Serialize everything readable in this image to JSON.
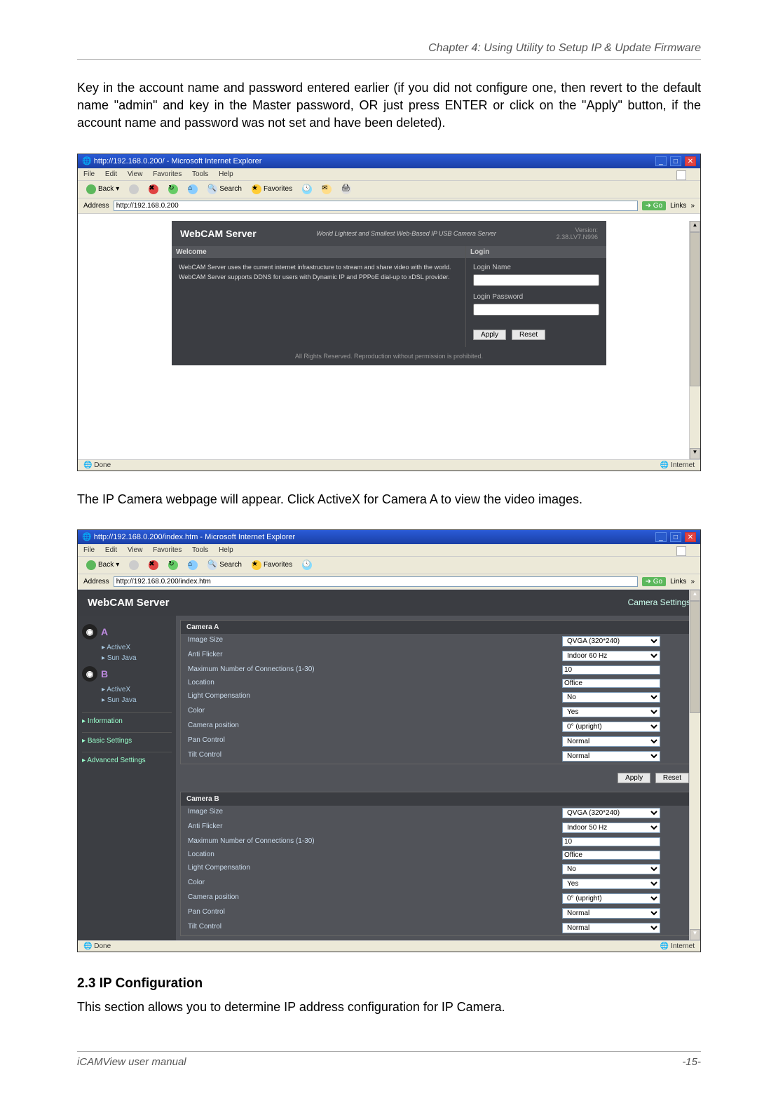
{
  "chapter_header": "Chapter 4: Using Utility to Setup IP & Update Firmware",
  "intro_text": "Key in the account name and password entered earlier (if you did not configure one, then revert to the default name \"admin\" and key in the Master password, OR just press ENTER or click on the \"Apply\" button, if the account name and password was not set and have been deleted).",
  "s1": {
    "title": "http://192.168.0.200/ - Microsoft Internet Explorer",
    "menubar": [
      "File",
      "Edit",
      "View",
      "Favorites",
      "Tools",
      "Help"
    ],
    "toolbar": {
      "back": "Back",
      "search": "Search",
      "favorites": "Favorites"
    },
    "address_label": "Address",
    "address_value": "http://192.168.0.200",
    "go": "Go",
    "links": "Links",
    "webcam_title": "WebCAM Server",
    "subtitle": "World Lightest and Smallest\nWeb-Based IP USB Camera Server",
    "version_label": "Version:",
    "version_value": "2.38.LV7.N996",
    "welcome_header": "Welcome",
    "welcome_text1": "WebCAM Server uses the current internet infrastructure to stream and share video with the world.",
    "welcome_text2": "WebCAM Server supports DDNS for users with Dynamic IP and PPPoE dial-up to xDSL provider.",
    "login_header": "Login",
    "login_name": "Login Name",
    "login_password": "Login Password",
    "apply": "Apply",
    "reset": "Reset",
    "footer": "All Rights Reserved. Reproduction without permission is prohibited.",
    "status_left": "Done",
    "status_right": "Internet"
  },
  "mid_text": "The IP Camera webpage will appear.   Click ActiveX for Camera A to view the video images.",
  "s2": {
    "title": "http://192.168.0.200/index.htm - Microsoft Internet Explorer",
    "address_value": "http://192.168.0.200/index.htm",
    "banner_title": "WebCAM Server",
    "camera_settings": "Camera Settings",
    "sidebar": {
      "activex": "ActiveX",
      "sunjava": "Sun Java",
      "information": "Information",
      "basic": "Basic Settings",
      "advanced": "Advanced Settings"
    },
    "camA": {
      "title": "Camera A",
      "rows": [
        {
          "label": "Image Size",
          "value": "QVGA (320*240)",
          "type": "select"
        },
        {
          "label": "Anti Flicker",
          "value": "Indoor 60 Hz",
          "type": "select"
        },
        {
          "label": "Maximum Number of Connections (1-30)",
          "value": "10",
          "type": "input"
        },
        {
          "label": "Location",
          "value": "Office",
          "type": "input"
        },
        {
          "label": "Light Compensation",
          "value": "No",
          "type": "select"
        },
        {
          "label": "Color",
          "value": "Yes",
          "type": "select"
        },
        {
          "label": "Camera position",
          "value": "0° (upright)",
          "type": "select"
        },
        {
          "label": "Pan Control",
          "value": "Normal",
          "type": "select"
        },
        {
          "label": "Tilt Control",
          "value": "Normal",
          "type": "select"
        }
      ]
    },
    "camB": {
      "title": "Camera B",
      "rows": [
        {
          "label": "Image Size",
          "value": "QVGA (320*240)",
          "type": "select"
        },
        {
          "label": "Anti Flicker",
          "value": "Indoor 50 Hz",
          "type": "select"
        },
        {
          "label": "Maximum Number of Connections (1-30)",
          "value": "10",
          "type": "input"
        },
        {
          "label": "Location",
          "value": "Office",
          "type": "input"
        },
        {
          "label": "Light Compensation",
          "value": "No",
          "type": "select"
        },
        {
          "label": "Color",
          "value": "Yes",
          "type": "select"
        },
        {
          "label": "Camera position",
          "value": "0° (upright)",
          "type": "select"
        },
        {
          "label": "Pan Control",
          "value": "Normal",
          "type": "select"
        },
        {
          "label": "Tilt Control",
          "value": "Normal",
          "type": "select"
        }
      ]
    },
    "apply": "Apply",
    "reset": "Reset",
    "status_left": "Done",
    "status_right": "Internet"
  },
  "section_heading": "2.3 IP Configuration",
  "section_text": "This section allows you to determine IP address configuration for IP Camera.",
  "footer_left": "iCAMView  user  manual",
  "footer_right": "-15-"
}
